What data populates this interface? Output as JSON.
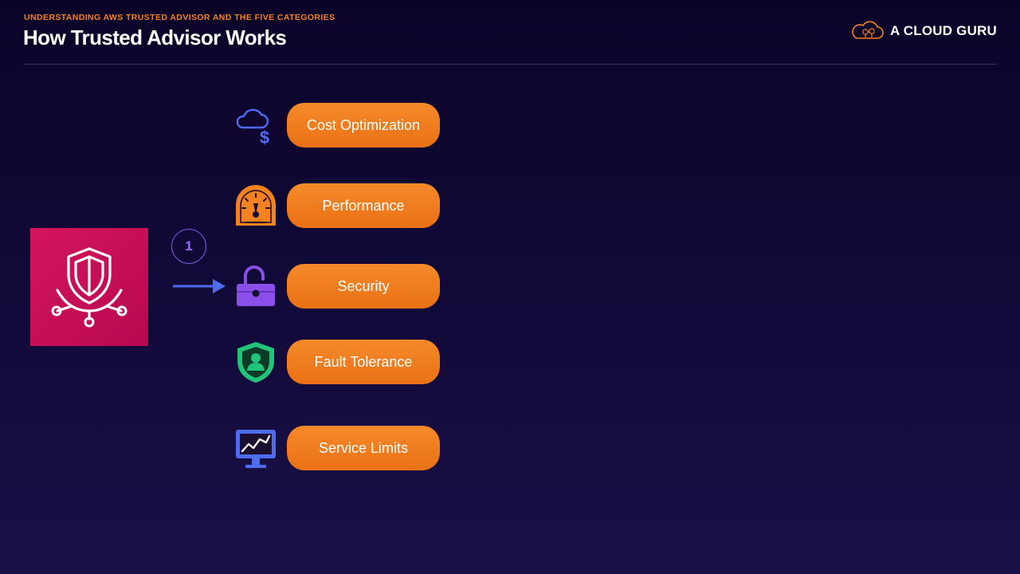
{
  "header": {
    "subtitle": "UNDERSTANDING AWS TRUSTED ADVISOR AND THE FIVE CATEGORIES",
    "title": "How Trusted Advisor Works"
  },
  "brand": {
    "name": "A CLOUD GURU",
    "accent": "#f58220"
  },
  "step": {
    "number": "1"
  },
  "categories": [
    {
      "label": "Cost Optimization",
      "icon": "cloud-dollar-icon",
      "color": "#4f6cf0"
    },
    {
      "label": "Performance",
      "icon": "speedometer-icon",
      "color": "#f58220"
    },
    {
      "label": "Security",
      "icon": "padlock-icon",
      "color": "#8a4fe8"
    },
    {
      "label": "Fault Tolerance",
      "icon": "shield-user-icon",
      "color": "#22c47a"
    },
    {
      "label": "Service Limits",
      "icon": "monitor-chart-icon",
      "color": "#4f6cf0"
    }
  ],
  "colors": {
    "pill": "#f07a1c",
    "trusted_advisor_tile": "#c80f57",
    "arrow": "#4f6cf0",
    "step_badge": "#8a5cf0"
  }
}
